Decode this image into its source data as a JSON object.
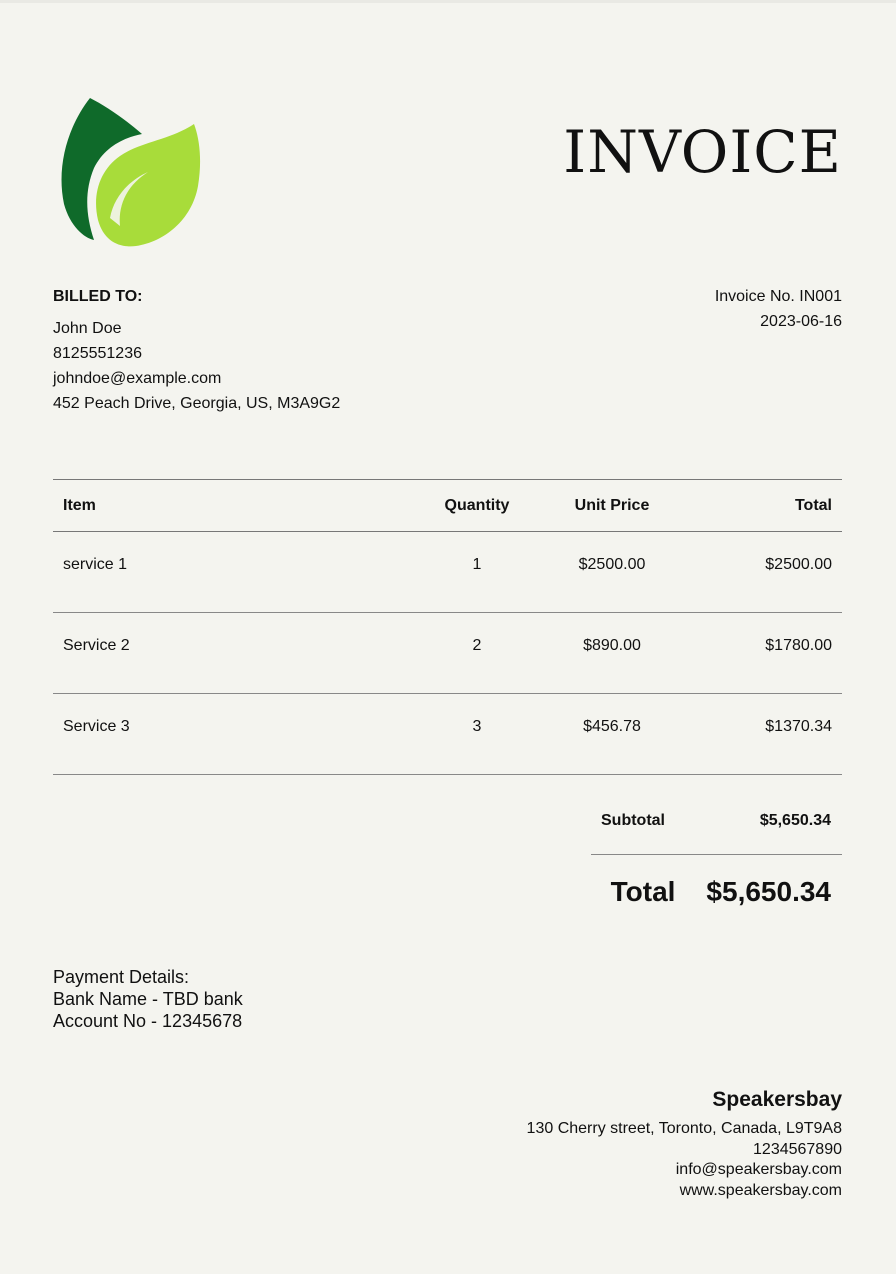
{
  "title": "INVOICE",
  "billed_to": {
    "label": "BILLED TO:",
    "name": "John Doe",
    "phone": "8125551236",
    "email": "johndoe@example.com",
    "address": "452 Peach Drive, Georgia, US, M3A9G2"
  },
  "invoice": {
    "number": "Invoice No. IN001",
    "date": "2023-06-16"
  },
  "table": {
    "headers": [
      "Item",
      "Quantity",
      "Unit Price",
      "Total"
    ],
    "rows": [
      [
        "service 1",
        "1",
        "$2500.00",
        "$2500.00"
      ],
      [
        "Service 2",
        "2",
        "$890.00",
        "$1780.00"
      ],
      [
        "Service 3",
        "3",
        "$456.78",
        "$1370.34"
      ]
    ]
  },
  "summary": {
    "subtotal_label": "Subtotal",
    "subtotal_value": "$5,650.34",
    "total_label": "Total",
    "total_value": "$5,650.34"
  },
  "payment": {
    "heading": "Payment Details:",
    "bank": "Bank Name - TBD bank",
    "account": "Account No - 12345678"
  },
  "company": {
    "name": "Speakersbay",
    "address": "130 Cherry street, Toronto, Canada, L9T9A8",
    "phone": "1234567890",
    "email": "info@speakersbay.com",
    "website": "www.speakersbay.com"
  },
  "colors": {
    "background": "#f4f4ef",
    "leaf_dark": "#0f6a2a",
    "leaf_light": "#a8dc3a"
  }
}
